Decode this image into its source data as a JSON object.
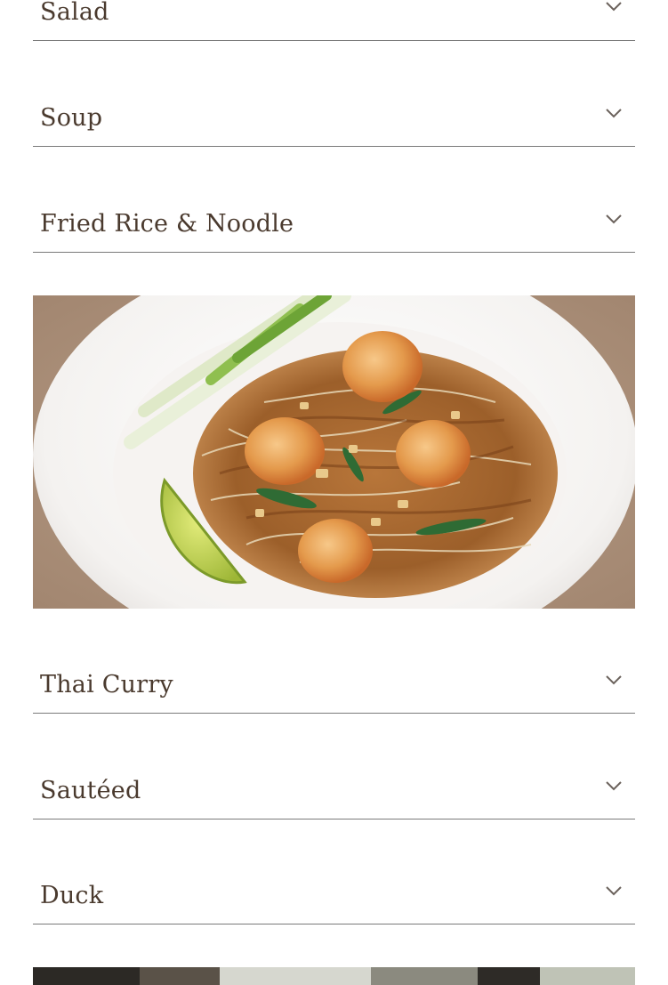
{
  "menu": {
    "sections": [
      {
        "label": "Salad",
        "icon": "chevron-down-icon"
      },
      {
        "label": "Soup",
        "icon": "chevron-down-icon"
      },
      {
        "label": "Fried Rice & Noodle",
        "icon": "chevron-down-icon"
      },
      {
        "label": "Thai Curry",
        "icon": "chevron-down-icon"
      },
      {
        "label": "Sautéed",
        "icon": "chevron-down-icon"
      },
      {
        "label": "Duck",
        "icon": "chevron-down-icon"
      }
    ]
  },
  "images": {
    "pad_thai": {
      "subject": "shrimp pad thai plate"
    },
    "bottom": {
      "subject": "restaurant photo (cropped)"
    }
  },
  "colors": {
    "text": "#4a3a2e",
    "divider": "#7a7a7a",
    "chevron": "#6b625c"
  }
}
